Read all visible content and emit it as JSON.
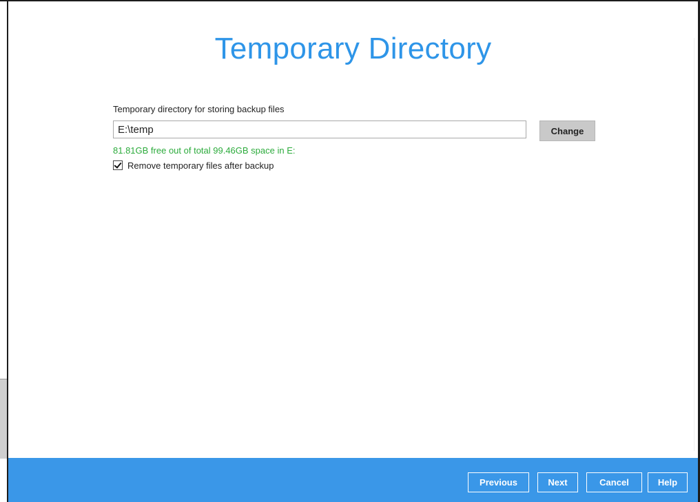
{
  "page": {
    "title": "Temporary Directory"
  },
  "temp_dir": {
    "label": "Temporary directory for storing backup files",
    "value": "E:\\temp",
    "change_label": "Change",
    "free_space_text": "81.81GB free out of total 99.46GB space in E:",
    "remove_temp_checked": true,
    "remove_temp_label": "Remove temporary files after backup"
  },
  "footer": {
    "previous_label": "Previous",
    "next_label": "Next",
    "cancel_label": "Cancel",
    "help_label": "Help"
  },
  "colors": {
    "title": "#2e95e8",
    "footer_bg": "#3a97e8",
    "free_space": "#2cab3c",
    "change_button_bg": "#c9c9c9"
  }
}
